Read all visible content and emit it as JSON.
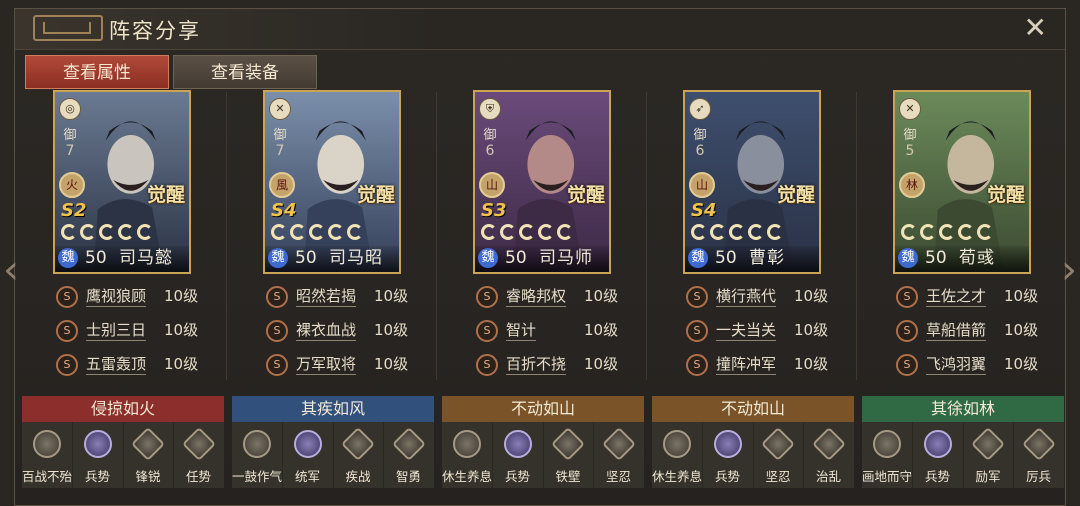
{
  "window": {
    "title": "阵容分享"
  },
  "tabs": [
    {
      "label": "查看属性",
      "active": true
    },
    {
      "label": "查看装备",
      "active": false
    }
  ],
  "generals": [
    {
      "name": "司马懿",
      "faction": "魏",
      "level": "50",
      "def_label": "御",
      "def_value": "7",
      "element": "火",
      "season": "S2",
      "awaken": "觉醒",
      "skills": [
        {
          "name": "鹰视狼顾",
          "level": "10级"
        },
        {
          "name": "士别三日",
          "level": "10级"
        },
        {
          "name": "五雷轰顶",
          "level": "10级"
        }
      ]
    },
    {
      "name": "司马昭",
      "faction": "魏",
      "level": "50",
      "def_label": "御",
      "def_value": "7",
      "element": "風",
      "season": "S4",
      "awaken": "觉醒",
      "skills": [
        {
          "name": "昭然若揭",
          "level": "10级"
        },
        {
          "name": "裸衣血战",
          "level": "10级"
        },
        {
          "name": "万军取将",
          "level": "10级"
        }
      ]
    },
    {
      "name": "司马师",
      "faction": "魏",
      "level": "50",
      "def_label": "御",
      "def_value": "6",
      "element": "山",
      "season": "S3",
      "awaken": "觉醒",
      "skills": [
        {
          "name": "睿略邦权",
          "level": "10级"
        },
        {
          "name": "智计",
          "level": "10级"
        },
        {
          "name": "百折不挠",
          "level": "10级"
        }
      ]
    },
    {
      "name": "曹彰",
      "faction": "魏",
      "level": "50",
      "def_label": "御",
      "def_value": "6",
      "element": "山",
      "season": "S4",
      "awaken": "觉醒",
      "skills": [
        {
          "name": "横行燕代",
          "level": "10级"
        },
        {
          "name": "一夫当关",
          "level": "10级"
        },
        {
          "name": "撞阵冲军",
          "level": "10级"
        }
      ]
    },
    {
      "name": "荀彧",
      "faction": "魏",
      "level": "50",
      "def_label": "御",
      "def_value": "5",
      "element": "林",
      "season": "",
      "awaken": "觉醒",
      "skills": [
        {
          "name": "王佐之才",
          "level": "10级"
        },
        {
          "name": "草船借箭",
          "level": "10级"
        },
        {
          "name": "飞鸿羽翼",
          "level": "10级"
        }
      ]
    }
  ],
  "teams": [
    {
      "name": "侵掠如火",
      "color": "#8c2f2c",
      "tactics": [
        "百战不殆",
        "兵势",
        "锋锐",
        "任势"
      ]
    },
    {
      "name": "其疾如风",
      "color": "#31507c",
      "tactics": [
        "一鼓作气",
        "统军",
        "疾战",
        "智勇"
      ]
    },
    {
      "name": "不动如山",
      "color": "#7a5428",
      "tactics": [
        "休生养息",
        "兵势",
        "铁壁",
        "坚忍"
      ]
    },
    {
      "name": "不动如山",
      "color": "#7a5428",
      "tactics": [
        "休生养息",
        "兵势",
        "坚忍",
        "治乱"
      ]
    },
    {
      "name": "其徐如林",
      "color": "#2f6a45",
      "tactics": [
        "画地而守",
        "兵势",
        "励军",
        "厉兵"
      ]
    }
  ],
  "colors": {
    "accent_gold": "#c9a455",
    "tab_active": "#a0402f"
  },
  "icons": {
    "close": "close-icon",
    "prev": "chevron-left-icon",
    "next": "chevron-right-icon"
  }
}
